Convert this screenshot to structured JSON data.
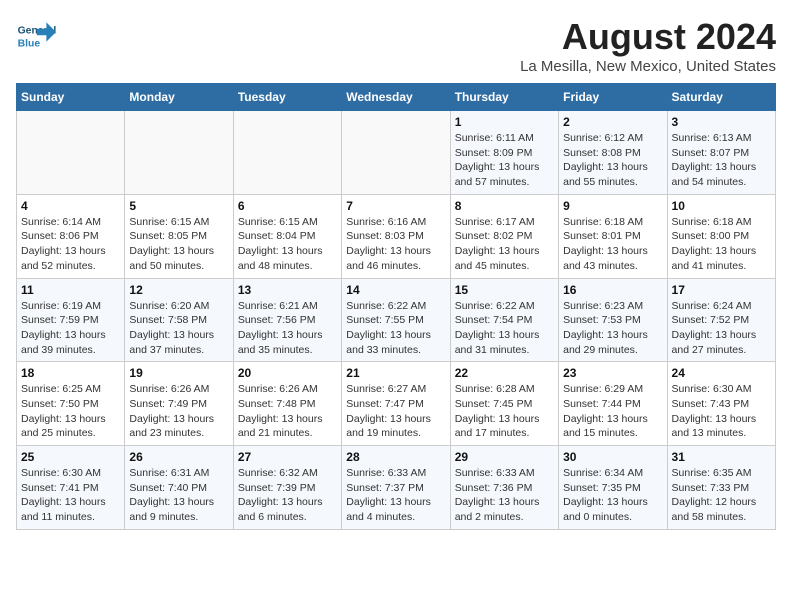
{
  "header": {
    "logo_text_1": "General",
    "logo_text_2": "Blue",
    "title": "August 2024",
    "subtitle": "La Mesilla, New Mexico, United States"
  },
  "weekdays": [
    "Sunday",
    "Monday",
    "Tuesday",
    "Wednesday",
    "Thursday",
    "Friday",
    "Saturday"
  ],
  "weeks": [
    [
      {
        "num": "",
        "info": ""
      },
      {
        "num": "",
        "info": ""
      },
      {
        "num": "",
        "info": ""
      },
      {
        "num": "",
        "info": ""
      },
      {
        "num": "1",
        "info": "Sunrise: 6:11 AM\nSunset: 8:09 PM\nDaylight: 13 hours\nand 57 minutes."
      },
      {
        "num": "2",
        "info": "Sunrise: 6:12 AM\nSunset: 8:08 PM\nDaylight: 13 hours\nand 55 minutes."
      },
      {
        "num": "3",
        "info": "Sunrise: 6:13 AM\nSunset: 8:07 PM\nDaylight: 13 hours\nand 54 minutes."
      }
    ],
    [
      {
        "num": "4",
        "info": "Sunrise: 6:14 AM\nSunset: 8:06 PM\nDaylight: 13 hours\nand 52 minutes."
      },
      {
        "num": "5",
        "info": "Sunrise: 6:15 AM\nSunset: 8:05 PM\nDaylight: 13 hours\nand 50 minutes."
      },
      {
        "num": "6",
        "info": "Sunrise: 6:15 AM\nSunset: 8:04 PM\nDaylight: 13 hours\nand 48 minutes."
      },
      {
        "num": "7",
        "info": "Sunrise: 6:16 AM\nSunset: 8:03 PM\nDaylight: 13 hours\nand 46 minutes."
      },
      {
        "num": "8",
        "info": "Sunrise: 6:17 AM\nSunset: 8:02 PM\nDaylight: 13 hours\nand 45 minutes."
      },
      {
        "num": "9",
        "info": "Sunrise: 6:18 AM\nSunset: 8:01 PM\nDaylight: 13 hours\nand 43 minutes."
      },
      {
        "num": "10",
        "info": "Sunrise: 6:18 AM\nSunset: 8:00 PM\nDaylight: 13 hours\nand 41 minutes."
      }
    ],
    [
      {
        "num": "11",
        "info": "Sunrise: 6:19 AM\nSunset: 7:59 PM\nDaylight: 13 hours\nand 39 minutes."
      },
      {
        "num": "12",
        "info": "Sunrise: 6:20 AM\nSunset: 7:58 PM\nDaylight: 13 hours\nand 37 minutes."
      },
      {
        "num": "13",
        "info": "Sunrise: 6:21 AM\nSunset: 7:56 PM\nDaylight: 13 hours\nand 35 minutes."
      },
      {
        "num": "14",
        "info": "Sunrise: 6:22 AM\nSunset: 7:55 PM\nDaylight: 13 hours\nand 33 minutes."
      },
      {
        "num": "15",
        "info": "Sunrise: 6:22 AM\nSunset: 7:54 PM\nDaylight: 13 hours\nand 31 minutes."
      },
      {
        "num": "16",
        "info": "Sunrise: 6:23 AM\nSunset: 7:53 PM\nDaylight: 13 hours\nand 29 minutes."
      },
      {
        "num": "17",
        "info": "Sunrise: 6:24 AM\nSunset: 7:52 PM\nDaylight: 13 hours\nand 27 minutes."
      }
    ],
    [
      {
        "num": "18",
        "info": "Sunrise: 6:25 AM\nSunset: 7:50 PM\nDaylight: 13 hours\nand 25 minutes."
      },
      {
        "num": "19",
        "info": "Sunrise: 6:26 AM\nSunset: 7:49 PM\nDaylight: 13 hours\nand 23 minutes."
      },
      {
        "num": "20",
        "info": "Sunrise: 6:26 AM\nSunset: 7:48 PM\nDaylight: 13 hours\nand 21 minutes."
      },
      {
        "num": "21",
        "info": "Sunrise: 6:27 AM\nSunset: 7:47 PM\nDaylight: 13 hours\nand 19 minutes."
      },
      {
        "num": "22",
        "info": "Sunrise: 6:28 AM\nSunset: 7:45 PM\nDaylight: 13 hours\nand 17 minutes."
      },
      {
        "num": "23",
        "info": "Sunrise: 6:29 AM\nSunset: 7:44 PM\nDaylight: 13 hours\nand 15 minutes."
      },
      {
        "num": "24",
        "info": "Sunrise: 6:30 AM\nSunset: 7:43 PM\nDaylight: 13 hours\nand 13 minutes."
      }
    ],
    [
      {
        "num": "25",
        "info": "Sunrise: 6:30 AM\nSunset: 7:41 PM\nDaylight: 13 hours\nand 11 minutes."
      },
      {
        "num": "26",
        "info": "Sunrise: 6:31 AM\nSunset: 7:40 PM\nDaylight: 13 hours\nand 9 minutes."
      },
      {
        "num": "27",
        "info": "Sunrise: 6:32 AM\nSunset: 7:39 PM\nDaylight: 13 hours\nand 6 minutes."
      },
      {
        "num": "28",
        "info": "Sunrise: 6:33 AM\nSunset: 7:37 PM\nDaylight: 13 hours\nand 4 minutes."
      },
      {
        "num": "29",
        "info": "Sunrise: 6:33 AM\nSunset: 7:36 PM\nDaylight: 13 hours\nand 2 minutes."
      },
      {
        "num": "30",
        "info": "Sunrise: 6:34 AM\nSunset: 7:35 PM\nDaylight: 13 hours\nand 0 minutes."
      },
      {
        "num": "31",
        "info": "Sunrise: 6:35 AM\nSunset: 7:33 PM\nDaylight: 12 hours\nand 58 minutes."
      }
    ]
  ]
}
